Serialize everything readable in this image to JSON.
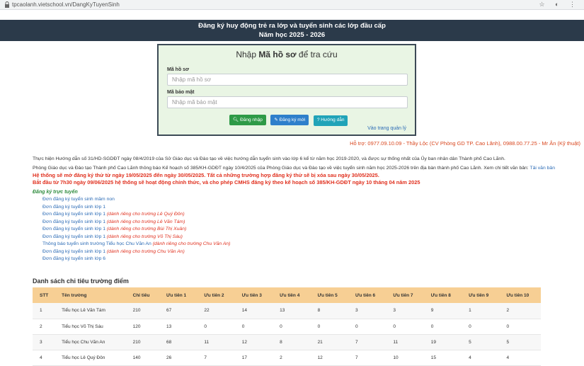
{
  "browser": {
    "url": "tpcaolanh.vietschool.vn/DangKyTuyenSinh"
  },
  "header": {
    "line1": "Đăng ký huy động trẻ ra lớp và tuyển sinh các lớp đầu cấp",
    "line2": "Năm học 2025 - 2026"
  },
  "login": {
    "title_prefix": "Nhập ",
    "title_bold": "Mã hồ sơ",
    "title_suffix": " để tra cứu",
    "code_label": "Mã hồ sơ",
    "code_placeholder": "Nhập mã hồ sơ",
    "secret_label": "Mã bảo mật",
    "secret_placeholder": "Nhập mã bảo mật",
    "login_button": "Đăng nhập",
    "register_button": "Đăng ký mới",
    "help_button": "Hướng dẫn",
    "admin_link": "Vào trang quản lý"
  },
  "support_text": "Hỗ trợ: 0977.09.10.09 - Thầy Lộc (CV Phòng GD TP. Cao Lãnh), 0988.00.77.25 - Mr Ân (Kỹ thuật)",
  "intro": {
    "para1": "Thực hiện Hướng dẫn số 31/HD-SGDĐT ngày 08/4/2019 của Sở Giáo dục và Đào tạo về việc hướng dẫn tuyển sinh vào lớp 6 kể từ năm học 2019-2020, và được sự thống nhất của Ủy ban nhân dân Thành phố Cao Lãnh.",
    "para2": "Phòng Giáo dục và Đào tạo Thành phố Cao Lãnh thông báo Kế hoạch số 385/KH-GDĐT ngày 10/4/2025 của Phòng Giáo dục và Đào tạo về việc tuyển sinh năm học 2025-2026 trên địa bàn thành phố Cao Lãnh. Xem chi tiết văn bản:",
    "doc_link": "Tải văn bản",
    "notice1": "Hệ thống sẽ mở đăng ký thử từ ngày 19/05/2025 đến ngày 30/05/2025. Tất cả những trường hợp đăng ký thử sẽ bị xóa sau ngày 30/05/2025.",
    "notice2": "Bắt đầu từ 7h30 ngày 09/06/2025 hệ thống sẽ hoạt động chính thức, và cho phép CMHS đăng ký theo kế hoạch số 385/KH-GDĐT ngày 10 tháng 04 năm 2025"
  },
  "online": {
    "title": "Đăng ký trực tuyến",
    "links": [
      {
        "text": "Đơn đăng ký tuyển sinh mầm non",
        "note": ""
      },
      {
        "text": "Đơn đăng ký tuyển sinh lớp 1",
        "note": ""
      },
      {
        "text": "Đơn đăng ký tuyển sinh lớp 1",
        "note": "(dành riêng cho trường Lê Quý Đôn)"
      },
      {
        "text": "Đơn đăng ký tuyển sinh lớp 1",
        "note": "(dành riêng cho trường Lê Văn Tám)"
      },
      {
        "text": "Đơn đăng ký tuyển sinh lớp 1",
        "note": "(dành riêng cho trường Bùi Thị Xuân)"
      },
      {
        "text": "Đơn đăng ký tuyển sinh lớp 1",
        "note": "(dành riêng cho trường Võ Thị Sáu)"
      },
      {
        "text": "Thông báo tuyển sinh trường Tiểu học Chu Văn An",
        "note": "(dành riêng cho trường Chu Văn An)"
      },
      {
        "text": "Đơn đăng ký tuyển sinh lớp 1",
        "note": "(dành riêng cho trường Chu Văn An)"
      },
      {
        "text": "Đơn đăng ký tuyển sinh lớp 6",
        "note": ""
      }
    ]
  },
  "table": {
    "title": "Danh sách chỉ tiêu trường điểm",
    "headers": [
      "STT",
      "Tên trường",
      "Chỉ tiêu",
      "Ưu tiên 1",
      "Ưu tiên 2",
      "Ưu tiên 3",
      "Ưu tiên 4",
      "Ưu tiên 5",
      "Ưu tiên 6",
      "Ưu tiên 7",
      "Ưu tiên 8",
      "Ưu tiên 9",
      "Ưu tiên 10"
    ],
    "rows": [
      [
        "1",
        "Tiểu học Lê Văn Tám",
        "210",
        "67",
        "22",
        "14",
        "13",
        "8",
        "3",
        "3",
        "9",
        "1",
        "2"
      ],
      [
        "2",
        "Tiểu học Võ Thị Sáu",
        "120",
        "13",
        "0",
        "0",
        "0",
        "0",
        "0",
        "0",
        "0",
        "0",
        "0"
      ],
      [
        "3",
        "Tiểu học Chu Văn An",
        "210",
        "68",
        "11",
        "12",
        "8",
        "21",
        "7",
        "11",
        "19",
        "5",
        "5"
      ],
      [
        "4",
        "Tiểu học Lê Quý Đôn",
        "140",
        "26",
        "7",
        "17",
        "2",
        "12",
        "7",
        "10",
        "15",
        "4",
        "4"
      ]
    ]
  },
  "colors": {
    "header_bg": "#2b3a4a",
    "panel_bg": "#e9f5e4",
    "table_header_bg": "#f7cf94",
    "notice_red": "#e0301e",
    "link_blue": "#2a6ab5"
  }
}
